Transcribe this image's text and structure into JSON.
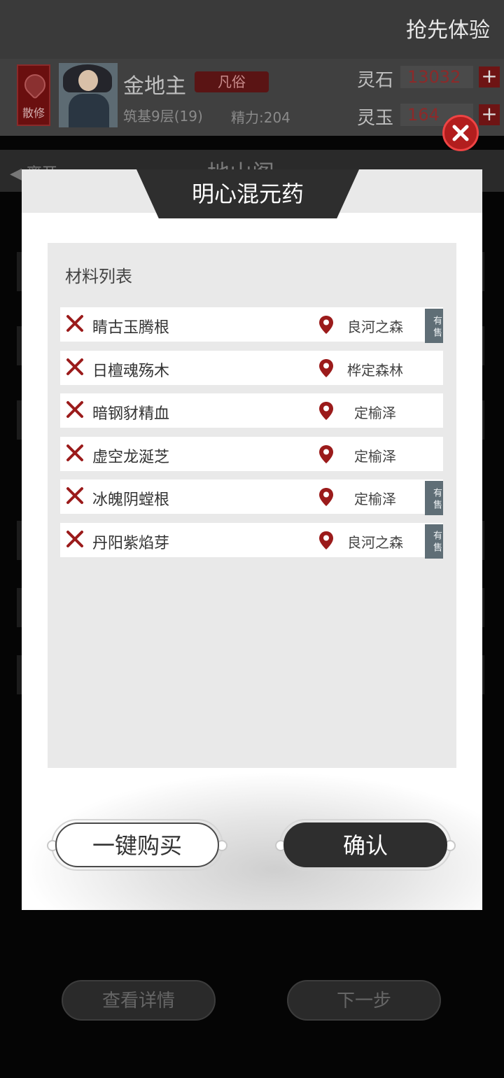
{
  "header": {
    "promo_label": "抢先体验"
  },
  "profile": {
    "badge_label": "散修",
    "name": "金地主",
    "rank_tag": "凡俗",
    "realm": "筑基9层(19)",
    "stamina": "精力:204",
    "currencies": [
      {
        "label": "灵石",
        "value": "13032"
      },
      {
        "label": "灵玉",
        "value": "164"
      }
    ]
  },
  "subnav": {
    "back_label": "离开",
    "page_title": "地山阁"
  },
  "modal": {
    "title": "明心混元药",
    "list_title": "材料列表",
    "sale_label": "有售",
    "materials": [
      {
        "name": "睛古玉腾根",
        "location": "良河之森",
        "on_sale": true
      },
      {
        "name": "日檀魂殇木",
        "location": "桦定森林",
        "on_sale": false
      },
      {
        "name": "暗钢豺精血",
        "location": "定榆泽",
        "on_sale": false
      },
      {
        "name": "虚空龙涎芝",
        "location": "定榆泽",
        "on_sale": false
      },
      {
        "name": "冰魄阴螳根",
        "location": "定榆泽",
        "on_sale": true
      },
      {
        "name": "丹阳紫焰芽",
        "location": "良河之森",
        "on_sale": true
      }
    ],
    "buy_all_label": "一键购买",
    "confirm_label": "确认"
  },
  "background_buttons": {
    "details_label": "查看详情",
    "next_label": "下一步"
  },
  "colors": {
    "accent_red": "#9b1b1b",
    "dark": "#2e2e2e",
    "sale_badge": "#5f6e76"
  }
}
